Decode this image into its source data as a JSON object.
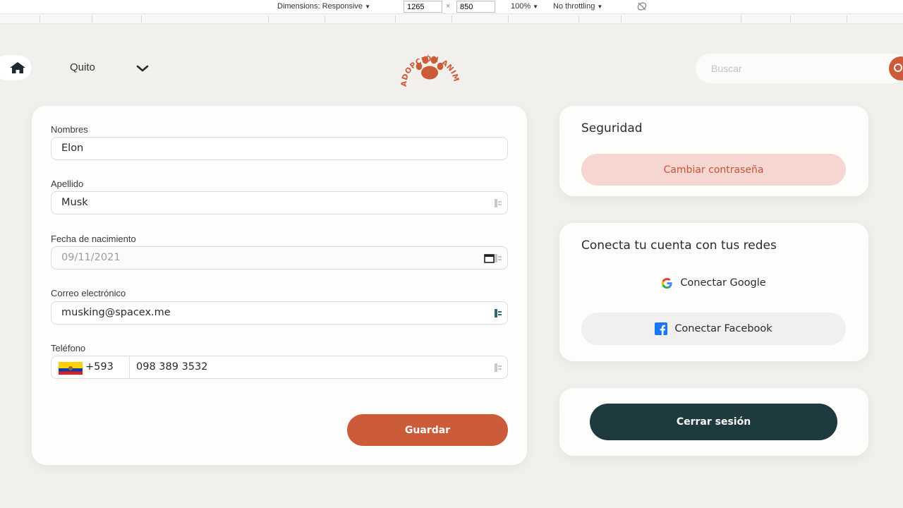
{
  "devtools": {
    "dimensions_label": "Dimensions: Responsive",
    "width": "1265",
    "height": "850",
    "times": "×",
    "zoom": "100%",
    "throttling": "No throttling"
  },
  "header": {
    "city": "Quito",
    "logo_text": "ADOPCIÓN ANIMAL.ORG",
    "search_placeholder": "Buscar"
  },
  "form": {
    "nombres": {
      "label": "Nombres",
      "value": "Elon"
    },
    "apellido": {
      "label": "Apellido",
      "value": "Musk"
    },
    "fecha": {
      "label": "Fecha de nacimiento",
      "value": "09/11/2021"
    },
    "correo": {
      "label": "Correo electrónico",
      "value": "musking@spacex.me"
    },
    "telefono": {
      "label": "Teléfono",
      "code": "+593",
      "number": "098 389 3532",
      "country": "ecuador-flag-icon"
    },
    "save_label": "Guardar"
  },
  "security": {
    "title": "Seguridad",
    "change_password_label": "Cambiar contraseña"
  },
  "social": {
    "title": "Conecta tu cuenta con tus redes",
    "google_label": "Conectar Google",
    "facebook_label": "Conectar Facebook"
  },
  "logout": {
    "label": "Cerrar sesión"
  },
  "colors": {
    "accent": "#cc5b3a",
    "dark": "#1f3a3e",
    "pink": "#f6d6d0",
    "background": "#f2f0ec"
  }
}
